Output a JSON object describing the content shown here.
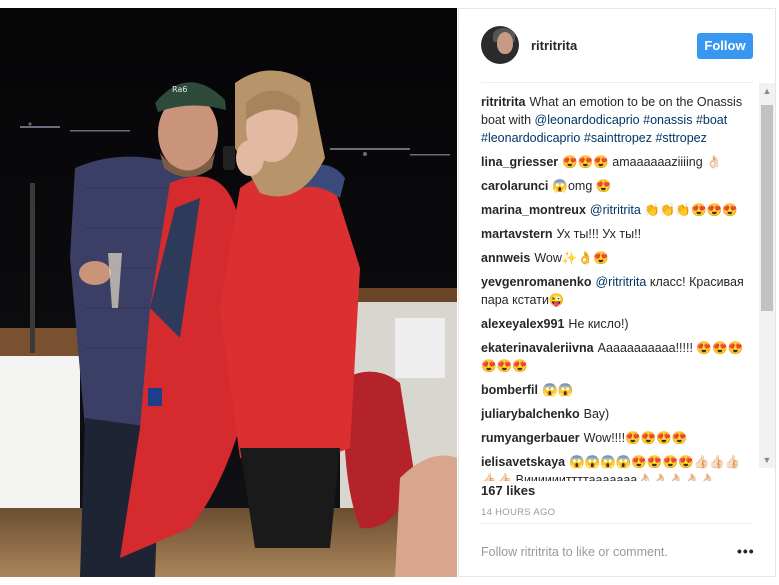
{
  "header": {
    "username": "ritritrita",
    "follow_label": "Follow"
  },
  "comments": [
    {
      "user": "ritritrita",
      "parts": [
        {
          "type": "text",
          "value": "What an emotion to be on the Onassis boat with "
        },
        {
          "type": "mention",
          "value": "@leonardodicaprio"
        },
        {
          "type": "text",
          "value": " "
        },
        {
          "type": "mention",
          "value": "#onassis"
        },
        {
          "type": "text",
          "value": " "
        },
        {
          "type": "mention",
          "value": "#boat"
        },
        {
          "type": "text",
          "value": " "
        },
        {
          "type": "mention",
          "value": "#leonardodicaprio"
        },
        {
          "type": "text",
          "value": " "
        },
        {
          "type": "mention",
          "value": "#sainttropez"
        },
        {
          "type": "text",
          "value": " "
        },
        {
          "type": "mention",
          "value": "#sttropez"
        }
      ]
    },
    {
      "user": "lina_griesser",
      "parts": [
        {
          "type": "text",
          "value": "😍😍😍 amaaaaaaziiiing 👌🏻"
        }
      ]
    },
    {
      "user": "carolarunci",
      "parts": [
        {
          "type": "text",
          "value": "😱omg 😍"
        }
      ]
    },
    {
      "user": "marina_montreux",
      "parts": [
        {
          "type": "mention",
          "value": "@ritritrita"
        },
        {
          "type": "text",
          "value": " 👏👏👏😍😍😍"
        }
      ]
    },
    {
      "user": "martavstern",
      "parts": [
        {
          "type": "text",
          "value": "Ух ты!!! Ух ты!!"
        }
      ]
    },
    {
      "user": "annweis",
      "parts": [
        {
          "type": "text",
          "value": "Wow✨👌😍"
        }
      ]
    },
    {
      "user": "yevgenromanenko",
      "parts": [
        {
          "type": "mention",
          "value": "@ritritrita"
        },
        {
          "type": "text",
          "value": " класс! Красивая пара кстати😜"
        }
      ]
    },
    {
      "user": "alexeyalex991",
      "parts": [
        {
          "type": "text",
          "value": "Не кисло!)"
        }
      ]
    },
    {
      "user": "ekaterinavaleriivna",
      "parts": [
        {
          "type": "text",
          "value": "Ааааааааааа!!!!! 😍😍😍😍😍😍"
        }
      ]
    },
    {
      "user": "bomberfil",
      "parts": [
        {
          "type": "text",
          "value": "😱😱"
        }
      ]
    },
    {
      "user": "juliarybalchenko",
      "parts": [
        {
          "type": "text",
          "value": "Вау)"
        }
      ]
    },
    {
      "user": "rumyangerbauer",
      "parts": [
        {
          "type": "text",
          "value": "Wow!!!!😍😍😍😍"
        }
      ]
    },
    {
      "user": "ielisavetskaya",
      "parts": [
        {
          "type": "text",
          "value": "😱😱😱😱😍😍😍😍👍🏻👍🏻👍🏻👍🏻👍🏻 Вииииииттттааааааа👌🏻👌🏻👌🏻👌🏻👌🏻"
        }
      ]
    }
  ],
  "likes": "167 likes",
  "timestamp": "14 HOURS AGO",
  "footer": {
    "prompt": "Follow ritritrita to like or comment.",
    "more_label": "•••"
  },
  "icons": {
    "scroll_up": "chevron-up-icon",
    "scroll_down": "chevron-down-icon",
    "more": "more-options-icon"
  },
  "colors": {
    "follow_button": "#3897f0",
    "mention": "#003569",
    "muted": "#999999",
    "jacket_red": "#d52a2e"
  }
}
